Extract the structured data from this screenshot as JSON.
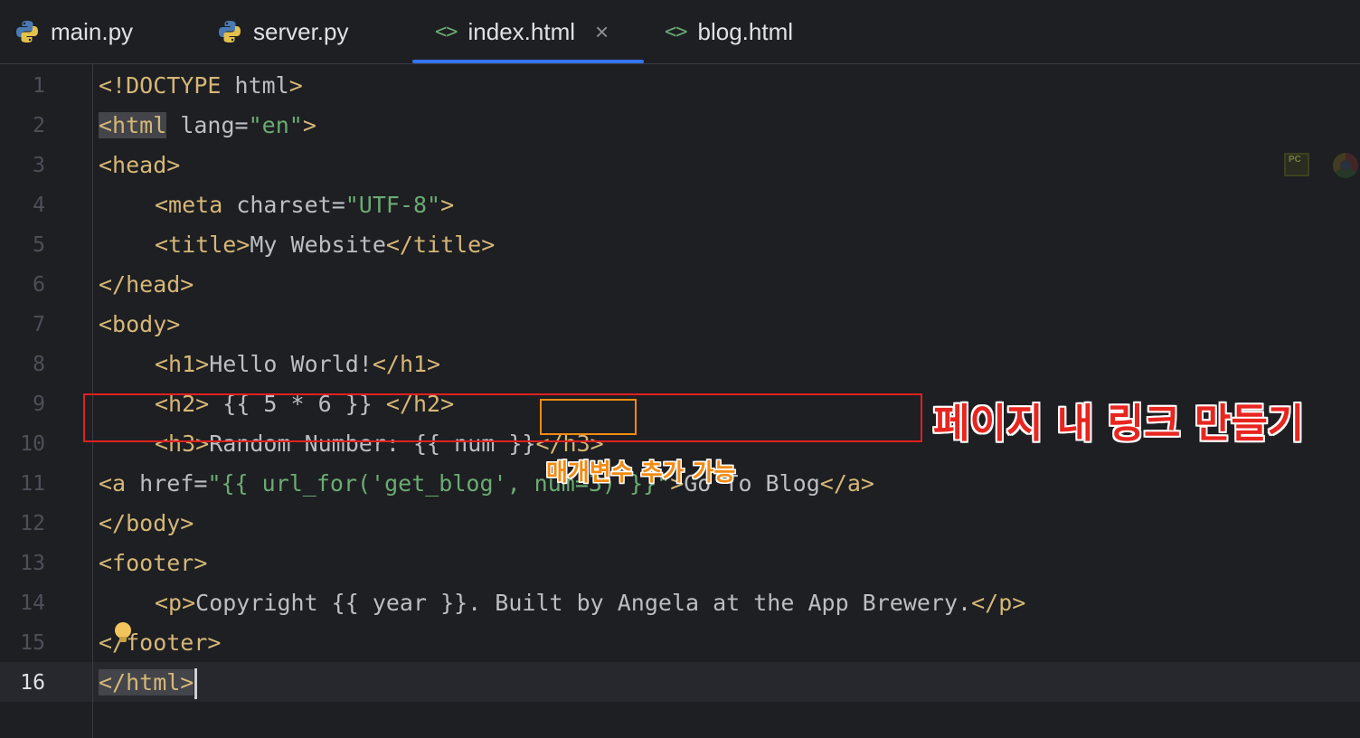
{
  "tabs": [
    {
      "label": "main.py",
      "icon": "python-icon"
    },
    {
      "label": "server.py",
      "icon": "python-icon"
    },
    {
      "label": "index.html",
      "icon": "html-icon",
      "active": true,
      "close": "×"
    },
    {
      "label": "blog.html",
      "icon": "html-icon"
    }
  ],
  "editor": {
    "active_line": 16,
    "lines": [
      {
        "n": "1"
      },
      {
        "n": "2"
      },
      {
        "n": "3"
      },
      {
        "n": "4"
      },
      {
        "n": "5"
      },
      {
        "n": "6"
      },
      {
        "n": "7"
      },
      {
        "n": "8"
      },
      {
        "n": "9"
      },
      {
        "n": "10"
      },
      {
        "n": "11"
      },
      {
        "n": "12"
      },
      {
        "n": "13"
      },
      {
        "n": "14"
      },
      {
        "n": "15"
      },
      {
        "n": "16"
      }
    ],
    "code": {
      "l1": [
        "<!DOCTYPE",
        " html",
        ">"
      ],
      "l2": [
        "<html",
        " lang",
        "=",
        "\"en\"",
        ">"
      ],
      "l3": "<head>",
      "l4": [
        "<meta",
        " charset",
        "=",
        "\"UTF-8\"",
        ">"
      ],
      "l5": [
        "<title>",
        "My Website",
        "</title>"
      ],
      "l6": "</head>",
      "l7": "<body>",
      "l8": [
        "<h1>",
        "Hello World!",
        "</h1>"
      ],
      "l9": [
        "<h2>",
        " {{ 5 * 6 }} ",
        "</h2>"
      ],
      "l10": [
        "<h3>",
        "Random Number: {{ num }}",
        "</h3>"
      ],
      "l11": [
        "<a",
        " href",
        "=",
        "\"{{ url_for('get_blog', num=3) }}\"",
        ">",
        "Go To Blog",
        "</a>"
      ],
      "l12": "</body>",
      "l13": "<footer>",
      "l14": [
        "<p>",
        "Copyright {{ year }}. Built by Angela at the App Brewery.",
        "</p>"
      ],
      "l15": "</footer>",
      "l16": "</html>"
    }
  },
  "annotations": {
    "title": "페이지 내 링크 만들기",
    "subtitle": "매개변수 추가 가능"
  },
  "toolbar_icons": [
    "pycharm-icon",
    "chrome-icon"
  ],
  "colors": {
    "background": "#1e1f22",
    "tag": "#d5b778",
    "string": "#6aab73",
    "text": "#bcbec4",
    "tab_accent": "#3574f0",
    "annotation_red": "#e8251f",
    "annotation_orange": "#f28b12"
  }
}
